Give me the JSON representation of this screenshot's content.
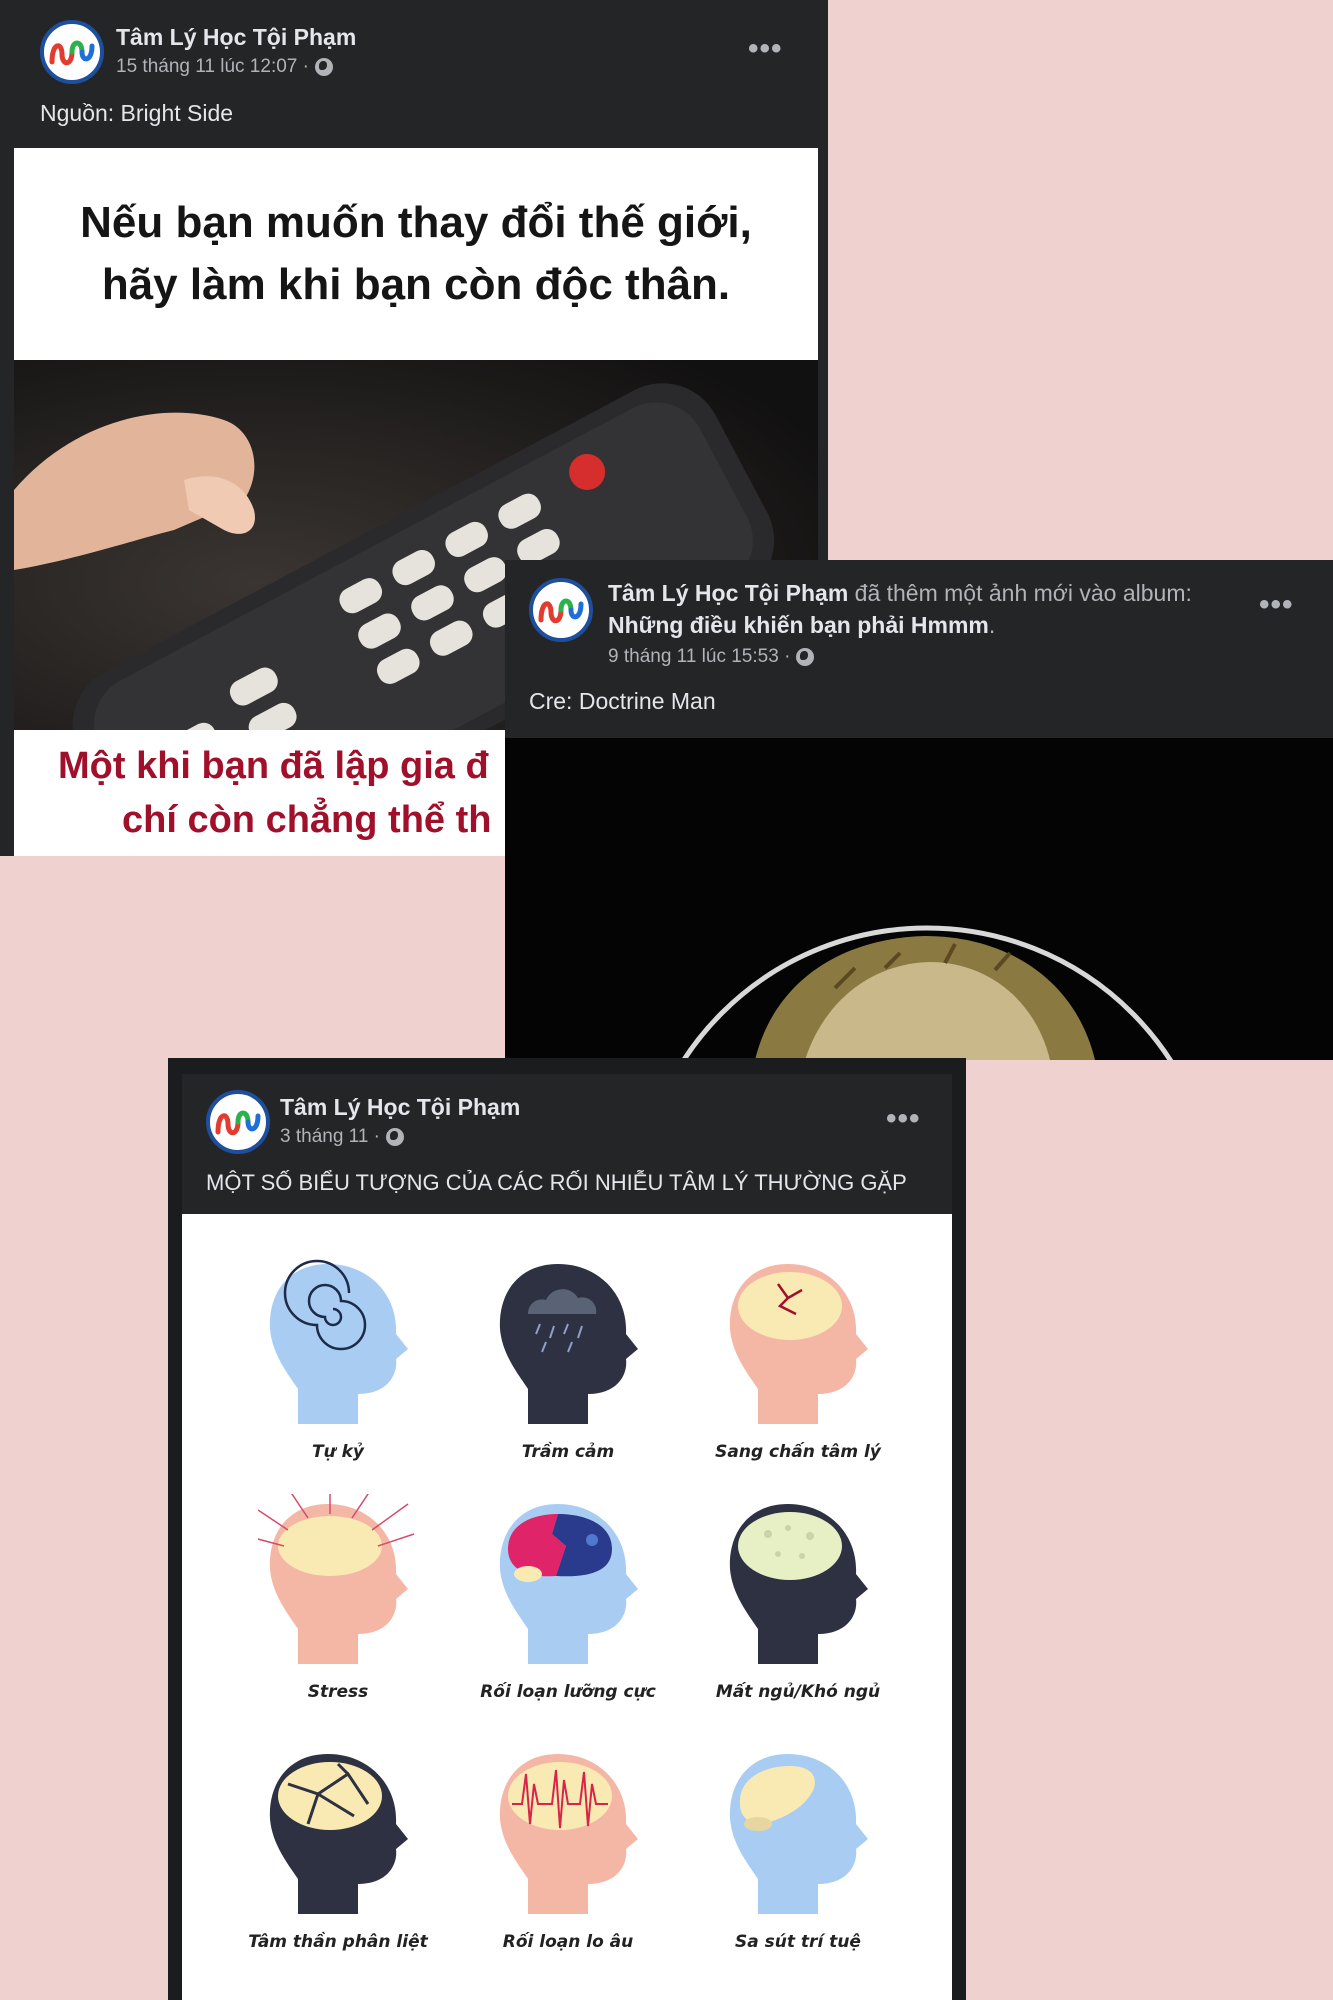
{
  "colors": {
    "background": "#efd1d0",
    "card": "#242526",
    "text": "#e4e6eb",
    "muted": "#b0b3b8",
    "meme_red": "#a0102a"
  },
  "post1": {
    "author": "Tâm Lý Học Tội Phạm",
    "timestamp": "15 tháng 11 lúc 12:07 ·",
    "caption": "Nguồn: Bright Side",
    "meme_top": [
      "Nếu bạn muốn thay đổi thế giới,",
      "hãy làm khi bạn còn độc thân."
    ],
    "meme_bottom": [
      "Một khi bạn đã lập gia đ",
      "chí còn chẳng thể th"
    ]
  },
  "post2": {
    "author": "Tâm Lý Học Tội Phạm",
    "action": "đã thêm một ảnh mới vào album:",
    "album": "Những điều khiến bạn phải Hmmm",
    "album_suffix": ".",
    "timestamp": "9 tháng 11 lúc 15:53 ·",
    "caption": "Cre: Doctrine Man"
  },
  "post3": {
    "author": "Tâm Lý Học Tội Phạm",
    "timestamp": "3 tháng 11 ·",
    "caption": "MỘT SỐ BIỂU TƯỢNG CỦA CÁC RỐI NHIỄU TÂM LÝ THƯỜNG GẶP",
    "heads": [
      {
        "label": "Tự kỷ",
        "icon": "spiral-head-icon"
      },
      {
        "label": "Trầm cảm",
        "icon": "rain-cloud-head-icon"
      },
      {
        "label": "Sang chấn tâm lý",
        "icon": "cracked-brain-head-icon"
      },
      {
        "label": "Stress",
        "icon": "radiating-lines-head-icon"
      },
      {
        "label": "Rối loạn lưỡng cực",
        "icon": "split-brain-head-icon"
      },
      {
        "label": "Mất ngủ/Khó ngủ",
        "icon": "dotted-brain-head-icon"
      },
      {
        "label": "Tâm thần phân liệt",
        "icon": "fractured-brain-head-icon"
      },
      {
        "label": "Rối loạn lo âu",
        "icon": "spike-wave-head-icon"
      },
      {
        "label": "Sa sút trí tuệ",
        "icon": "faded-brain-head-icon"
      }
    ]
  }
}
